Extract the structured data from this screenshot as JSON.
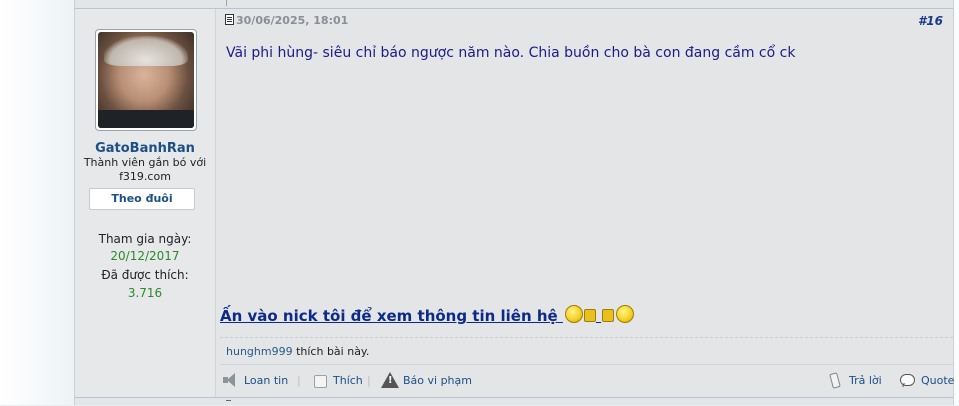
{
  "post": {
    "date": "30/06/2025, 18:01",
    "number": "#16",
    "message": "Vãi phi hùng- siêu chỉ báo ngược năm nào. Chia buồn cho bà con đang cầm cổ ck",
    "signature": "Ấn vào nick tôi để xem thông tin liên hệ",
    "likes": {
      "user": "hunghm999",
      "text": " thích bài này."
    }
  },
  "user": {
    "name": "GatoBanhRan",
    "title": "Thành viên gắn bó với f319.com",
    "follow_label": "Theo đuôi",
    "joined_label": "Tham gia ngày:",
    "joined_value": "20/12/2017",
    "liked_label": "Đã được thích:",
    "liked_value": "3.716"
  },
  "actions": {
    "report_spam": "Loan tin",
    "like": "Thích",
    "report": "Báo vi phạm",
    "reply": "Trả lời",
    "quote": "Quote"
  },
  "icons": [
    "document-icon",
    "smiley-icon",
    "thumbs-up-icon",
    "speaker-icon",
    "like-icon",
    "warning-icon",
    "reply-icon",
    "quote-icon"
  ]
}
